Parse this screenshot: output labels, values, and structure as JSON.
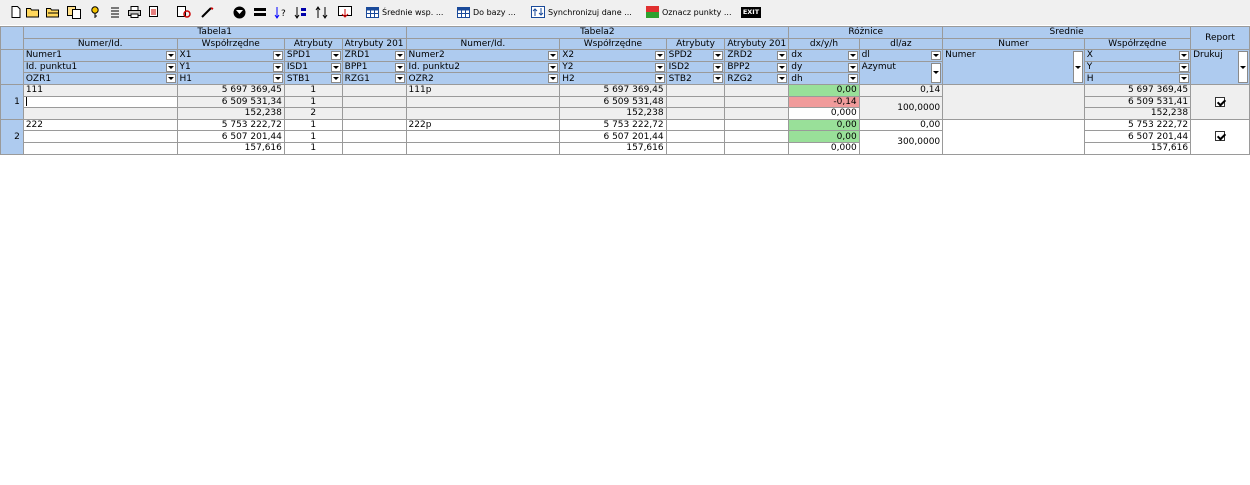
{
  "toolbar": {
    "buttons": [
      {
        "icon": "new-file-icon"
      },
      {
        "icon": "open-folder-icon"
      },
      {
        "icon": "open-folder-alt-icon"
      },
      {
        "icon": "copy-icon"
      },
      {
        "icon": "key-icon"
      },
      {
        "icon": "list-icon"
      },
      {
        "icon": "print-icon"
      },
      {
        "icon": "document-red-icon"
      },
      {
        "icon": "find-icon"
      },
      {
        "icon": "pencil-icon"
      },
      {
        "icon": "filter-icon"
      },
      {
        "icon": "equals-icon"
      },
      {
        "icon": "sort-question-icon"
      },
      {
        "icon": "sort-ascending-icon"
      },
      {
        "icon": "sort-icon"
      },
      {
        "icon": "import-icon"
      }
    ],
    "srednie_label": "Średnie wsp. ...",
    "dobazy_label": "Do bazy ...",
    "sync_label": "Synchronizuj dane ...",
    "oznacz_label": "Oznacz punkty ...",
    "exit_label": "EXIT"
  },
  "headers": {
    "tabela1": "Tabela1",
    "tabela2": "Tabela2",
    "roznice": "Różnice",
    "srednie": "Średnie",
    "report": "Report",
    "t1_numer": "Numer/Id.",
    "t1_wsp": "Współrzędne",
    "t1_atr": "Atrybuty",
    "t1_atr201": "Atrybuty 201",
    "t2_numer": "Numer/Id.",
    "t2_wsp": "Współrzędne",
    "t2_atr": "Atrybuty",
    "t2_atr201": "Atrybuty 201",
    "r_dx": "dx/y/h",
    "r_dl": "dl/az",
    "s_numer": "Numer",
    "s_wsp": "Współrzędne"
  },
  "config": {
    "r1": {
      "t1num": "Numer1",
      "t1wsp": "X1",
      "t1atr": "SPD1",
      "t1atr201": "ZRD1",
      "t2num": "Numer2",
      "t2wsp": "X2",
      "t2atr": "SPD2",
      "t2atr201": "ZRD2",
      "rdx": "dx",
      "rdl": "dl",
      "snum": "Numer",
      "swsp": "X",
      "report": "Drukuj"
    },
    "r2": {
      "t1num": "Id. punktu1",
      "t1wsp": "Y1",
      "t1atr": "ISD1",
      "t1atr201": "BPP1",
      "t2num": "Id. punktu2",
      "t2wsp": "Y2",
      "t2atr": "ISD2",
      "t2atr201": "BPP2",
      "rdx": "dy",
      "rdl": "Azymut",
      "swsp": "Y"
    },
    "r3": {
      "t1num": "OZR1",
      "t1wsp": "H1",
      "t1atr": "STB1",
      "t1atr201": "RZG1",
      "t2num": "OZR2",
      "t2wsp": "H2",
      "t2atr": "STB2",
      "t2atr201": "RZG2",
      "rdx": "dh",
      "swsp": "H"
    }
  },
  "records": [
    {
      "index": "1",
      "rows": [
        {
          "t1num": "111",
          "t1wsp": "5 697 369,45",
          "t1atr": "1",
          "t2num": "111p",
          "t2wsp": "5 697 369,45",
          "rdx": "0,00",
          "sw": "5 697 369,45"
        },
        {
          "t1num": "",
          "t1wsp": "6 509 531,34",
          "t1atr": "1",
          "t2num": "",
          "t2wsp": "6 509 531,48",
          "rdx": "-0,14",
          "sw": "6 509 531,41"
        },
        {
          "t1num": "",
          "t1wsp": "152,238",
          "t1atr": "2",
          "t2num": "",
          "t2wsp": "152,238",
          "rdx": "0,000",
          "sw": "152,238"
        }
      ],
      "dl": "0,14",
      "az": "100,0000",
      "report_checked": true
    },
    {
      "index": "2",
      "rows": [
        {
          "t1num": "222",
          "t1wsp": "5 753 222,72",
          "t1atr": "1",
          "t2num": "222p",
          "t2wsp": "5 753 222,72",
          "rdx": "0,00",
          "sw": "5 753 222,72"
        },
        {
          "t1num": "",
          "t1wsp": "6 507 201,44",
          "t1atr": "1",
          "t2num": "",
          "t2wsp": "6 507 201,44",
          "rdx": "0,00",
          "sw": "6 507 201,44"
        },
        {
          "t1num": "",
          "t1wsp": "157,616",
          "t1atr": "1",
          "t2num": "",
          "t2wsp": "157,616",
          "rdx": "0,000",
          "sw": "157,616"
        }
      ],
      "dl": "0,00",
      "az": "300,0000",
      "report_checked": true
    }
  ],
  "colors": {
    "header": "#aecbef",
    "diff_ok": "#99e099",
    "diff_bad": "#f09b9b"
  }
}
